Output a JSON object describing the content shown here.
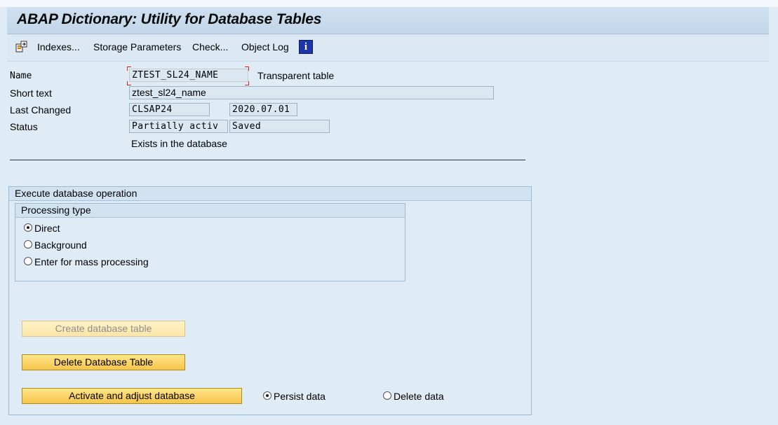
{
  "title": "ABAP Dictionary: Utility for Database Tables",
  "toolbar": {
    "icon": "settings-transfer-icon",
    "items": [
      "Indexes...",
      "Storage Parameters",
      "Check...",
      "Object Log"
    ],
    "info_icon": "info-icon"
  },
  "form": {
    "name_label": "Name",
    "name_value": "ZTEST_SL24_NAME",
    "table_type": "Transparent table",
    "short_text_label": "Short text",
    "short_text_value": "ztest_sl24_name",
    "last_changed_label": "Last Changed",
    "last_changed_user": "CLSAP24",
    "last_changed_date": "2020.07.01",
    "status_label": "Status",
    "status_value_1": "Partially activ",
    "status_value_2": "Saved",
    "db_existence": "Exists in the database"
  },
  "execute_group": {
    "title": "Execute database operation",
    "processing_type": {
      "title": "Processing type",
      "options": [
        {
          "label": "Direct",
          "checked": true
        },
        {
          "label": "Background",
          "checked": false
        },
        {
          "label": "Enter for mass processing",
          "checked": false
        }
      ]
    },
    "buttons": {
      "create": "Create database table",
      "delete": "Delete Database Table",
      "activate": "Activate and adjust database"
    },
    "data_options": [
      {
        "label": "Persist data",
        "checked": true
      },
      {
        "label": "Delete data",
        "checked": false
      }
    ]
  },
  "colors": {
    "background": "#dfebf5",
    "title_bar": "#c8dbed",
    "button": "#f9cf5a",
    "focus_marker": "#dd2222"
  }
}
